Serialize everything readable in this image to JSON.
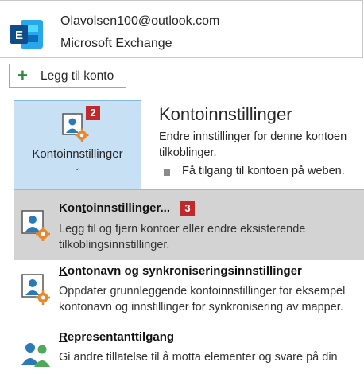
{
  "account": {
    "email": "Olavolsen100@outlook.com",
    "type": "Microsoft Exchange",
    "logo_icon": "exchange-logo-icon"
  },
  "add_account": {
    "label": "Legg til konto",
    "icon": "plus-icon"
  },
  "account_settings_button": {
    "label": "Kontoinnstillinger",
    "chevron": "⌄",
    "badge": "2",
    "icon": "account-settings-icon"
  },
  "header": {
    "title": "Kontoinnstillinger",
    "desc_line1": "Endre innstillinger for denne kontoen",
    "desc_line2": "tilkoblinger.",
    "bullet_text": "Få tilgang til kontoen på weben."
  },
  "menu": {
    "items": [
      {
        "title_prefix": "Kon",
        "title_accel": "t",
        "title_suffix": "oinnstillinger...",
        "badge": "3",
        "desc1": "Legg til og fjern kontoer eller endre eksisterende",
        "desc2": "tilkoblingsinnstillinger.",
        "icon": "account-settings-icon"
      },
      {
        "title_prefix": "",
        "title_accel": "K",
        "title_suffix": "ontonavn og synkroniseringsinnstillinger",
        "desc1": "Oppdater grunnleggende kontoinnstillinger for eksempel",
        "desc2": "kontonavn og innstillinger for synkronisering av mapper.",
        "icon": "account-settings-icon"
      },
      {
        "title_prefix": "",
        "title_accel": "R",
        "title_suffix": "epresentanttilgang",
        "desc1": "Gi andre tillatelse til å motta elementer og svare på din",
        "icon": "delegate-people-icon"
      }
    ]
  },
  "colors": {
    "accent": "#c7e0f4",
    "badge": "#c0282a",
    "hover": "#d3d3d3"
  }
}
